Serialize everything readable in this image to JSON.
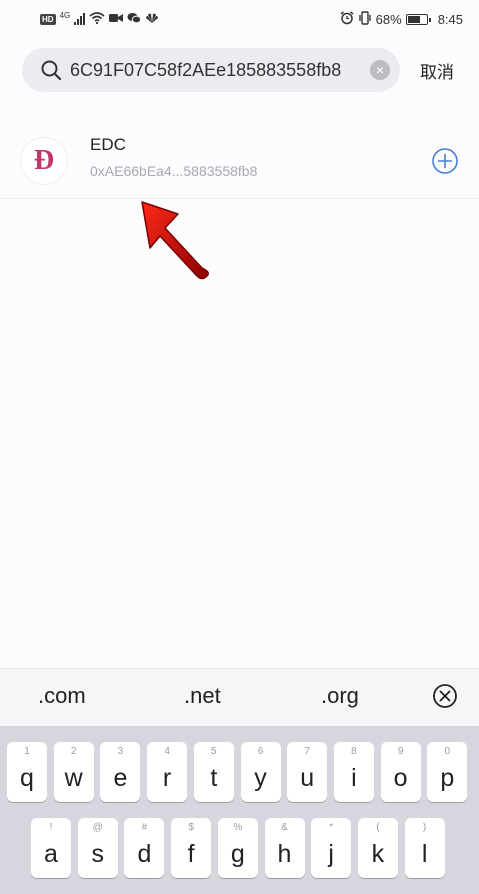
{
  "status_bar": {
    "hd": "HD",
    "network": "4G",
    "battery": "68%",
    "battery_level": 0.68,
    "time": "8:45"
  },
  "search": {
    "value": "6C91F07C58f2AEe185883558fb8",
    "cancel_label": "取消"
  },
  "result": {
    "logo_letter": "Đ",
    "symbol": "EDC",
    "address": "0xAE66bEa4...5883558fb8"
  },
  "keyboard": {
    "suggestions": [
      ".com",
      ".net",
      ".org"
    ],
    "row1": [
      {
        "hint": "1",
        "key": "q"
      },
      {
        "hint": "2",
        "key": "w"
      },
      {
        "hint": "3",
        "key": "e"
      },
      {
        "hint": "4",
        "key": "r"
      },
      {
        "hint": "5",
        "key": "t"
      },
      {
        "hint": "6",
        "key": "y"
      },
      {
        "hint": "7",
        "key": "u"
      },
      {
        "hint": "8",
        "key": "i"
      },
      {
        "hint": "9",
        "key": "o"
      },
      {
        "hint": "0",
        "key": "p"
      }
    ],
    "row2": [
      {
        "hint": "!",
        "key": "a"
      },
      {
        "hint": "@",
        "key": "s"
      },
      {
        "hint": "#",
        "key": "d"
      },
      {
        "hint": "$",
        "key": "f"
      },
      {
        "hint": "%",
        "key": "g"
      },
      {
        "hint": "&",
        "key": "h"
      },
      {
        "hint": "*",
        "key": "j"
      },
      {
        "hint": "(",
        "key": "k"
      },
      {
        "hint": ")",
        "key": "l"
      }
    ]
  },
  "colors": {
    "accent": "#4a7fd6",
    "annotation_arrow": "#d41010",
    "logo": "#c2366b"
  }
}
